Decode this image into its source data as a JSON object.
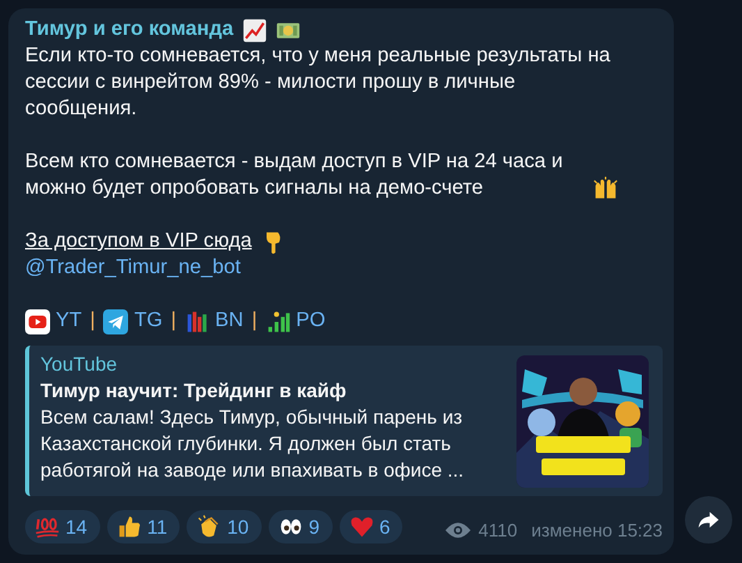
{
  "message": {
    "sender": "Тимур и его команда",
    "paragraphs": [
      {
        "text": "Если кто-то сомневается, что у меня реальные результаты на сессии с винрейтом 89% - милости прошу в личные сообщения."
      },
      {
        "text": "Всем кто сомневается - выдам доступ в VIP на 24 часа и можно будет опробовать сигналы на демо-счете"
      }
    ],
    "vip_link": {
      "text": "За доступом в VIP сюда"
    },
    "bot_link": "@Trader_Timur_ne_bot",
    "socials": [
      {
        "kind": "youtube",
        "label": "YT"
      },
      {
        "kind": "telegram",
        "label": "TG"
      },
      {
        "kind": "bars",
        "label": "BN"
      },
      {
        "kind": "signal",
        "label": "PO"
      }
    ],
    "separator": "|",
    "preview": {
      "site": "YouTube",
      "title": "Тимур научит: Трейдинг в кайф",
      "description": "Всем салам! Здесь Тимур, обычный парень из Казахстанской глубинки. Я должен был стать работягой на заводе или впахивать в офисе ..."
    },
    "reactions": [
      {
        "kind": "hundred",
        "count": "14"
      },
      {
        "kind": "thumbs-up",
        "count": "11"
      },
      {
        "kind": "clap",
        "count": "10"
      },
      {
        "kind": "eyes",
        "count": "9"
      },
      {
        "kind": "heart",
        "count": "6"
      }
    ],
    "views": "4110",
    "edited": "изменено 15:23"
  }
}
